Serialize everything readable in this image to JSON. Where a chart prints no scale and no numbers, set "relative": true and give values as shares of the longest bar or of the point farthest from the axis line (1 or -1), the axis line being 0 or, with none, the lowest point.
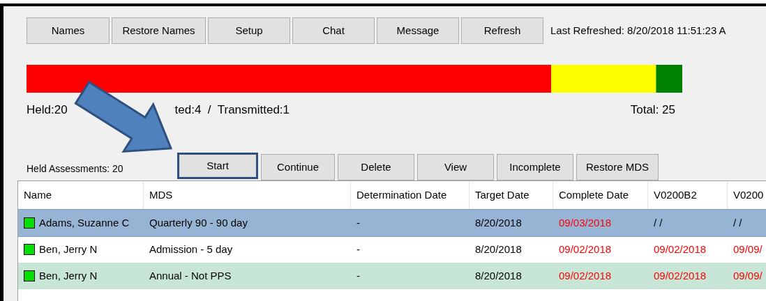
{
  "toolbar": {
    "buttons": [
      "Names",
      "Restore Names",
      "Setup",
      "Chat",
      "Message",
      "Refresh"
    ],
    "last_refreshed": "Last Refreshed: 8/20/2018 11:51:23 A"
  },
  "progress": {
    "chart_data": {
      "type": "bar",
      "orientation": "horizontal",
      "stacked": true,
      "relative": true,
      "series": [
        {
          "color": "#ff0000",
          "values": [
            0.8
          ]
        },
        {
          "color": "#ffff00",
          "values": [
            0.16
          ]
        },
        {
          "color": "#008000",
          "values": [
            0.04
          ]
        }
      ]
    },
    "held_label": "Held:20",
    "counts_label": "ted:4  /  Transmitted:1",
    "total": "Total: 25"
  },
  "actions": {
    "count_label": "Held Assessments: 20",
    "buttons": [
      {
        "label": "Start",
        "selected": true
      },
      {
        "label": "Continue",
        "selected": false
      },
      {
        "label": "Delete",
        "selected": false
      },
      {
        "label": "View",
        "selected": false
      },
      {
        "label": "Incomplete",
        "selected": false
      },
      {
        "label": "Restore MDS",
        "selected": false
      }
    ]
  },
  "table": {
    "columns": [
      "Name",
      "MDS",
      "Determination Date",
      "Target Date",
      "Complete Date",
      "V0200B2",
      "V0200"
    ],
    "rows": [
      {
        "selected": true,
        "color": "#98b4d4",
        "cells": [
          {
            "text": "Adams, Suzanne C",
            "late": false
          },
          {
            "text": "Quarterly 90 - 90 day",
            "late": false
          },
          {
            "text": "-",
            "late": false
          },
          {
            "text": "8/20/2018",
            "late": false
          },
          {
            "text": "09/03/2018",
            "late": true
          },
          {
            "text": "/ /",
            "late": false
          },
          {
            "text": "/ /",
            "late": false
          }
        ]
      },
      {
        "selected": false,
        "color": "#ffffff",
        "cells": [
          {
            "text": "Ben, Jerry N",
            "late": false
          },
          {
            "text": "Admission - 5 day",
            "late": false
          },
          {
            "text": "-",
            "late": false
          },
          {
            "text": "8/20/2018",
            "late": false
          },
          {
            "text": "09/02/2018",
            "late": true
          },
          {
            "text": "09/02/2018",
            "late": true
          },
          {
            "text": "09/09/",
            "late": true
          }
        ]
      },
      {
        "selected": false,
        "color": "#c8e6d8",
        "cells": [
          {
            "text": "Ben, Jerry N",
            "late": false
          },
          {
            "text": "Annual - Not PPS",
            "late": false
          },
          {
            "text": "-",
            "late": false
          },
          {
            "text": "8/20/2018",
            "late": false
          },
          {
            "text": "09/02/2018",
            "late": true
          },
          {
            "text": "09/02/2018",
            "late": true
          },
          {
            "text": "09/09/",
            "late": true
          }
        ]
      }
    ]
  }
}
